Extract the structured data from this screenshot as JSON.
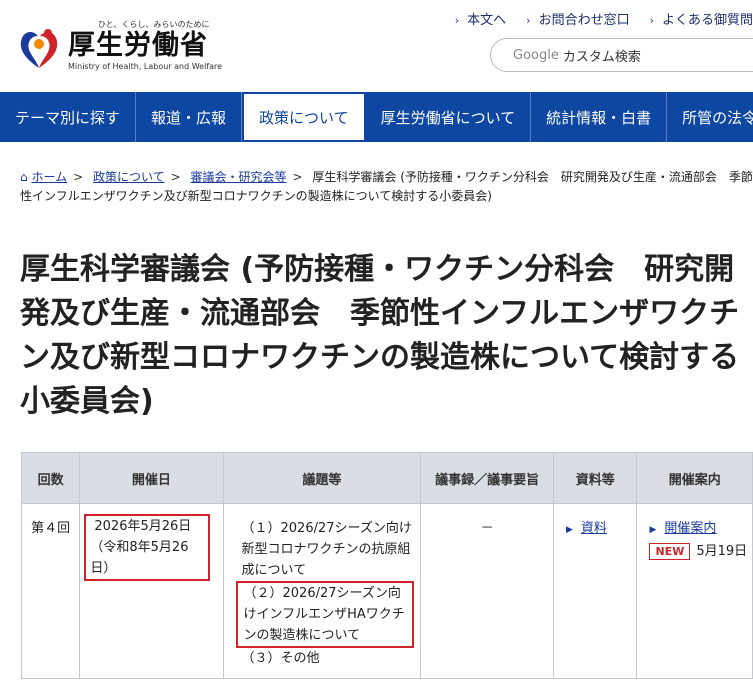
{
  "header": {
    "logo_tagline": "ひと、くらし、みらいのために",
    "logo_title": "厚生労働省",
    "logo_subtitle": "Ministry of Health, Labour and Welfare",
    "util_links": [
      "本文へ",
      "お問合わせ窓口",
      "よくある御質問"
    ],
    "search_brand": "Google",
    "search_placeholder": "カスタム検索"
  },
  "nav": {
    "items": [
      "テーマ別に探す",
      "報道・広報",
      "政策について",
      "厚生労働省について",
      "統計情報・白書",
      "所管の法令等"
    ]
  },
  "breadcrumb": {
    "home": "ホーム",
    "crumb1": "政策について",
    "crumb2": "審議会・研究会等",
    "current": "厚生科学審議会 (予防接種・ワクチン分科会　研究開発及び生産・流通部会　季節性インフルエンザワクチン及び新型コロナワクチンの製造株について検討する小委員会)"
  },
  "title": "厚生科学審議会 (予防接種・ワクチン分科会　研究開発及び生産・流通部会　季節性インフルエンザワクチン及び新型コロナワクチンの製造株について検討する小委員会)",
  "table": {
    "headers": [
      "回数",
      "開催日",
      "議題等",
      "議事録／議事要旨",
      "資料等",
      "開催案内"
    ],
    "row": {
      "no": "第４回",
      "date": "2026年5月26日",
      "date_wareki": "（令和8年5月26日）",
      "agenda1": "（１）2026/27シーズン向け新型コロナワクチンの抗原組成について",
      "agenda2": "（２）2026/27シーズン向けインフルエンザHAワクチンの製造株について",
      "agenda3": "（３）その他",
      "minutes": "－",
      "docs": "資料",
      "info_link": "開催案内",
      "info_badge": "NEW",
      "info_date": "5月19日"
    }
  },
  "colors": {
    "nav_bg": "#0d47a1",
    "highlight": "#d0242c"
  }
}
